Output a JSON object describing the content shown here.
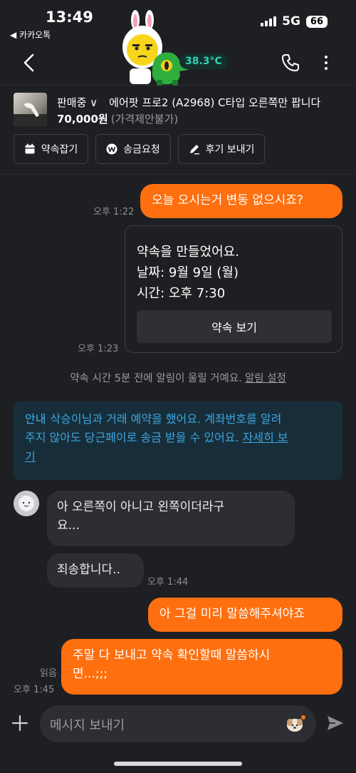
{
  "status_bar": {
    "time": "13:49",
    "back_app": "◀ 카카오톡",
    "network": "5G",
    "battery": "66"
  },
  "header": {
    "temperature": "38.3°C"
  },
  "product": {
    "status": "판매중 ∨",
    "title": "에어팟 프로2 (A2968) C타입 오른쪽만 팝니다",
    "price": "70,000원",
    "price_note": "(가격제안불가)"
  },
  "actions": {
    "appointment": "약속잡기",
    "request_payment": "송금요청",
    "send_review": "후기 보내기"
  },
  "messages": [
    {
      "from": "me",
      "text": "오늘 오시는거 변동 없으시죠?",
      "time": "오후 1:22"
    },
    {
      "from": "other",
      "type": "appointment",
      "time": "오후 1:23"
    },
    {
      "from": "other",
      "text": "아 오른쪽이 아니고 왼쪽이더라구",
      "text2": "요..."
    },
    {
      "from": "other",
      "text": "죄송합니다..",
      "time": "오후 1:44"
    },
    {
      "from": "me",
      "text": "아 그걸 미리 말씀해주셔야죠"
    },
    {
      "from": "me",
      "text": "주말 다 보내고 약속 확인할때 말씀하시",
      "text2": "면...;;;",
      "time": "오후 1:45",
      "read": "읽음"
    }
  ],
  "appointment_card": {
    "title": "약속을 만들었어요.",
    "date": "날짜: 9월 9일 (월)",
    "time": "시간: 오후 7:30",
    "button": "약속 보기"
  },
  "system_note": {
    "text": "약속 시간 5분 전에 알림이 울릴 거예요.",
    "link": "알림 설정"
  },
  "info": {
    "label": "안내",
    "text1": "삭승이님과 거래 예약을 했어요. 계좌번호를 알려",
    "text2": "주지 않아도 당근페이로 송금 받을 수 있어요.",
    "link1": "자세히 보",
    "link2": "기"
  },
  "input": {
    "placeholder": "메시지 보내기"
  },
  "colors": {
    "background": "#1e1f22",
    "accent": "#fe6f0f",
    "bubble_other": "#2d2e33",
    "info_text": "#3ea3dd",
    "temperature": "#34d2b4"
  },
  "icons": [
    "back-arrow-icon",
    "phone-icon",
    "more-icon",
    "calendar-icon",
    "won-icon",
    "pencil-icon",
    "plus-icon",
    "emoji-icon",
    "send-icon"
  ]
}
